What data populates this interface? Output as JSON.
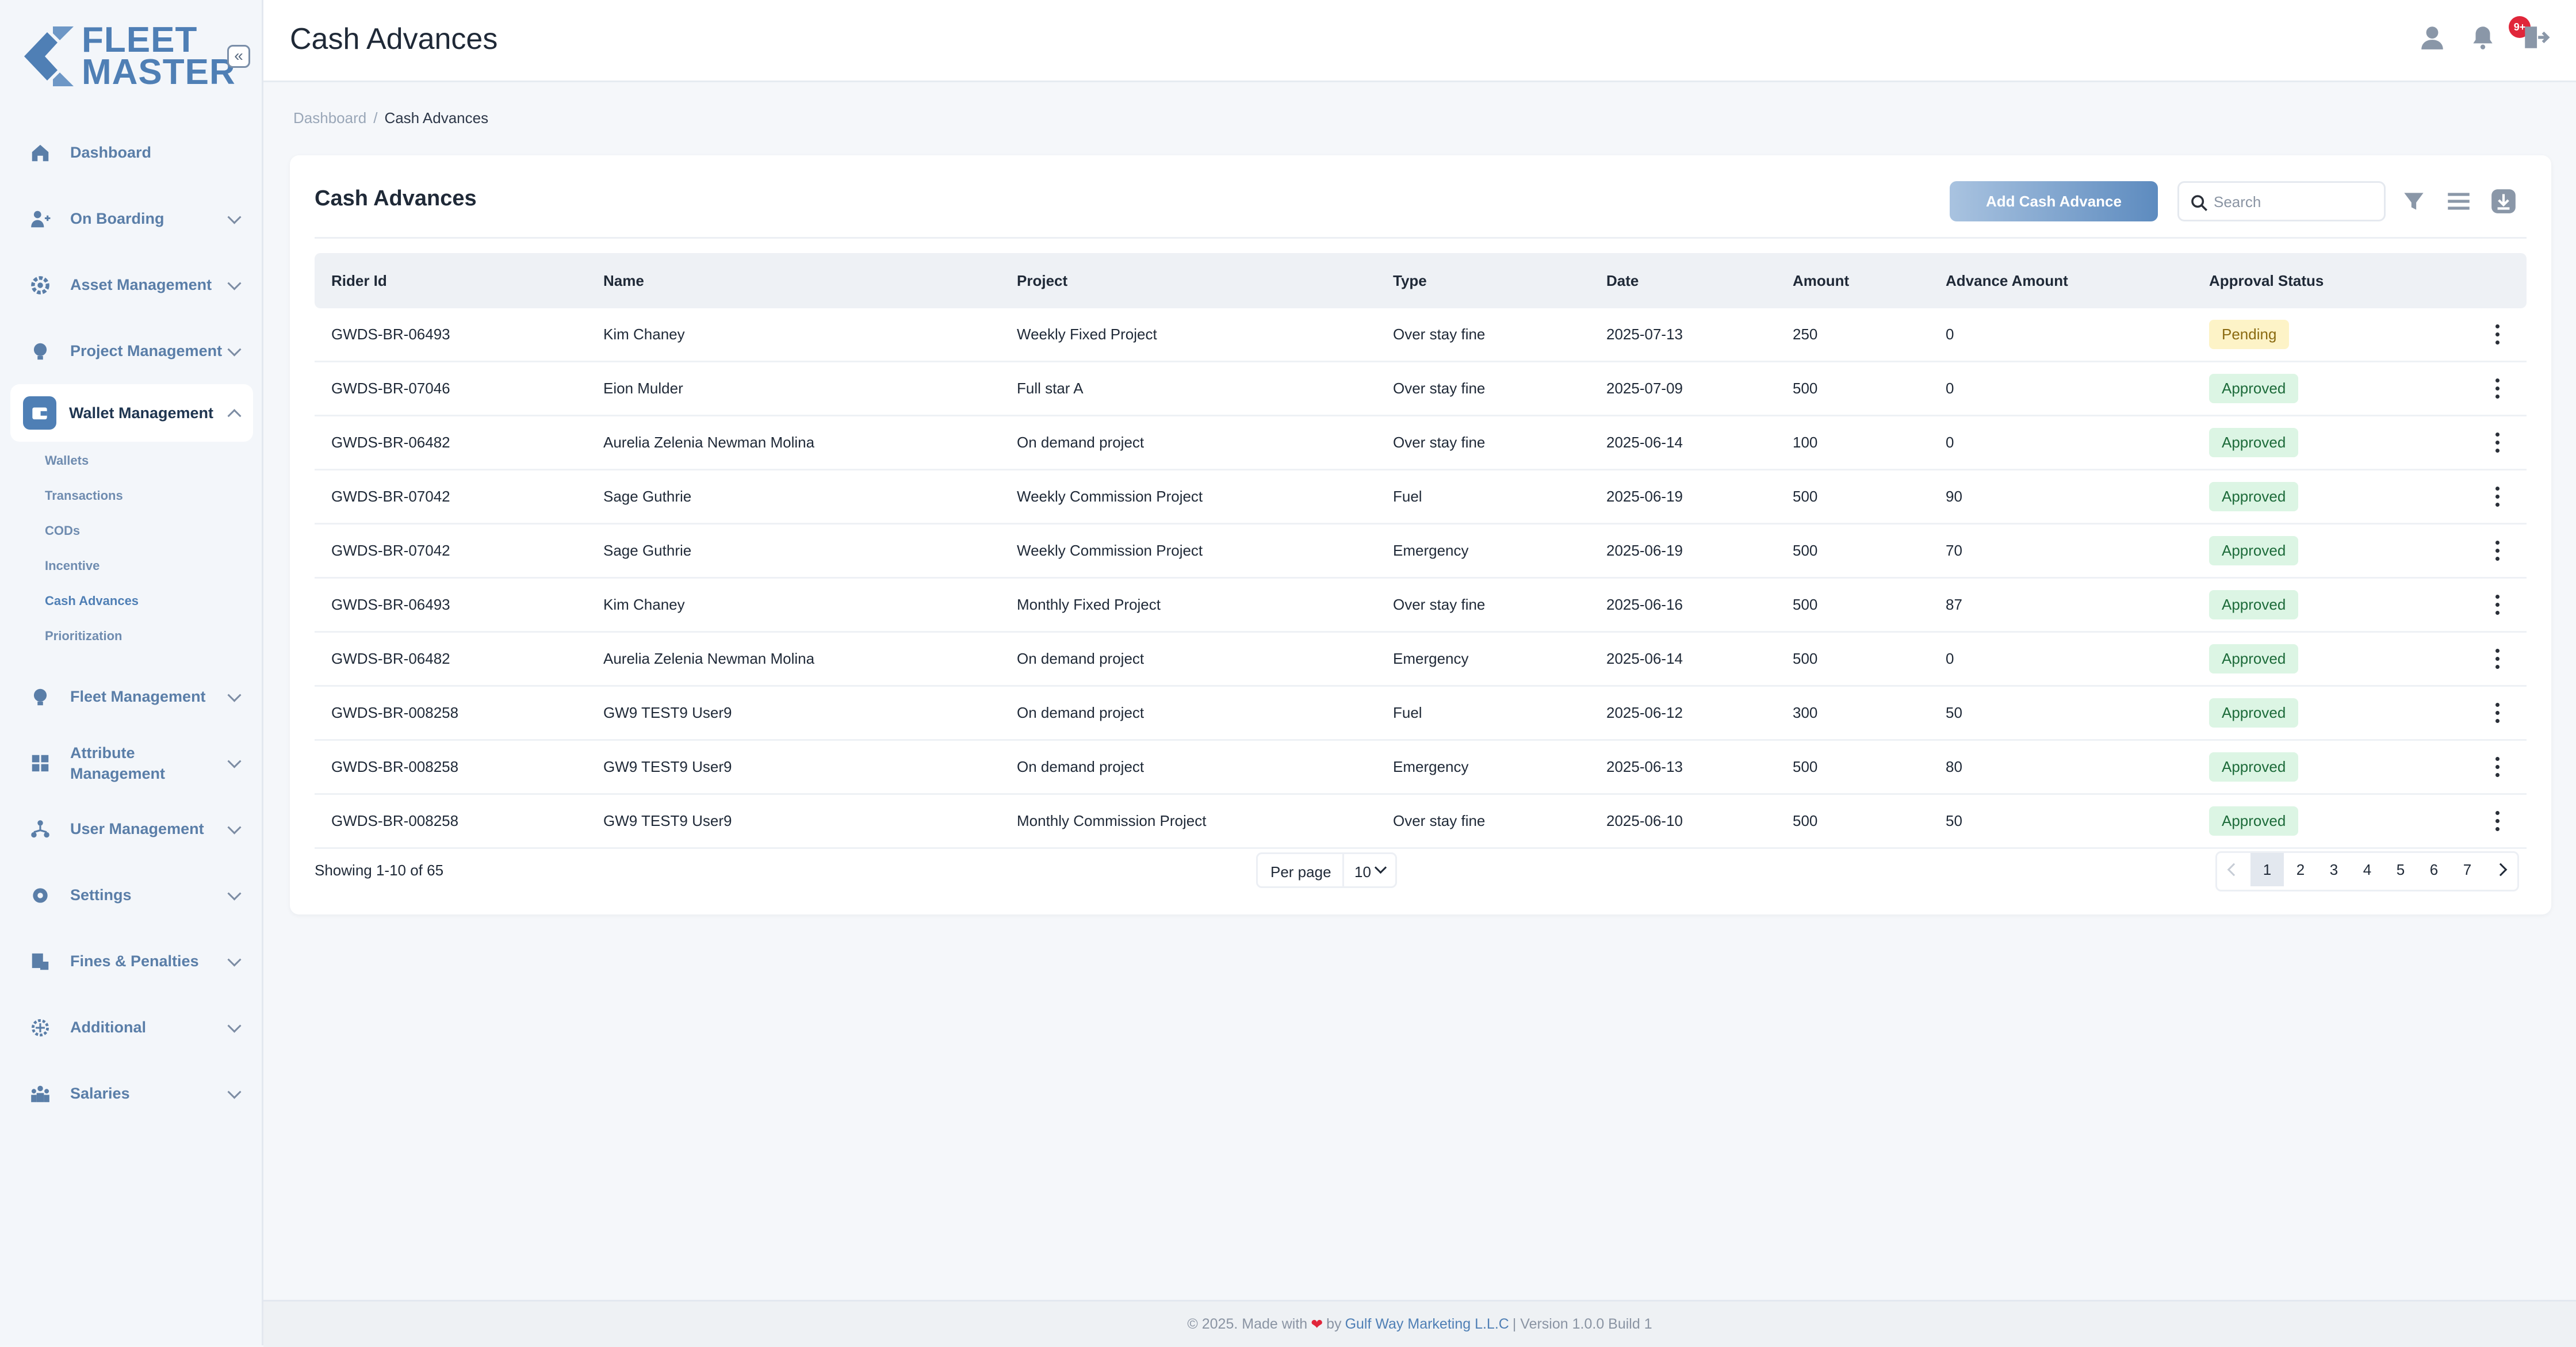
{
  "brand": {
    "line1": "FLEET",
    "line2": "MASTER",
    "color": "#4f7fb5"
  },
  "header": {
    "title": "Cash Advances",
    "notification_badge": "9+"
  },
  "breadcrumb": {
    "home": "Dashboard",
    "separator": "/",
    "current": "Cash Advances"
  },
  "sidebar": {
    "items": [
      {
        "label": "Dashboard",
        "icon": "home-icon"
      },
      {
        "label": "On Boarding",
        "icon": "user-plus-icon"
      },
      {
        "label": "Asset Management",
        "icon": "gear-cog-icon"
      },
      {
        "label": "Project Management",
        "icon": "bulb-icon"
      },
      {
        "label": "Wallet Management",
        "icon": "wallet-icon"
      },
      {
        "label": "Fleet Management",
        "icon": "car-icon"
      },
      {
        "label": "Attribute",
        "label2": "Management",
        "icon": "grid-icon"
      },
      {
        "label": "User Management",
        "icon": "users-icon"
      },
      {
        "label": "Settings",
        "icon": "settings-icon"
      },
      {
        "label": "Fines & Penalties",
        "icon": "receipt-icon"
      },
      {
        "label": "Additional",
        "icon": "plus-circle-icon"
      },
      {
        "label": "Salaries",
        "icon": "people-icon"
      }
    ],
    "wallet_sub": [
      "Wallets",
      "Transactions",
      "CODs",
      "Incentive",
      "Cash Advances",
      "Prioritization"
    ]
  },
  "card": {
    "title": "Cash Advances",
    "add_button": "Add Cash Advance",
    "search_placeholder": "Search"
  },
  "table": {
    "columns": [
      "Rider Id",
      "Name",
      "Project",
      "Type",
      "Date",
      "Amount",
      "Advance Amount",
      "Approval Status"
    ],
    "rows": [
      {
        "rider": "GWDS-BR-06493",
        "name": "Kim Chaney",
        "project": "Weekly Fixed Project",
        "type": "Over stay fine",
        "date": "2025-07-13",
        "amount": "250",
        "advance": "0",
        "status": "Pending"
      },
      {
        "rider": "GWDS-BR-07046",
        "name": "Eion Mulder",
        "project": "Full star A",
        "type": "Over stay fine",
        "date": "2025-07-09",
        "amount": "500",
        "advance": "0",
        "status": "Approved"
      },
      {
        "rider": "GWDS-BR-06482",
        "name": "Aurelia Zelenia Newman Molina",
        "project": "On demand project",
        "type": "Over stay fine",
        "date": "2025-06-14",
        "amount": "100",
        "advance": "0",
        "status": "Approved"
      },
      {
        "rider": "GWDS-BR-07042",
        "name": "Sage Guthrie",
        "project": "Weekly Commission Project",
        "type": "Fuel",
        "date": "2025-06-19",
        "amount": "500",
        "advance": "90",
        "status": "Approved"
      },
      {
        "rider": "GWDS-BR-07042",
        "name": "Sage Guthrie",
        "project": "Weekly Commission Project",
        "type": "Emergency",
        "date": "2025-06-19",
        "amount": "500",
        "advance": "70",
        "status": "Approved"
      },
      {
        "rider": "GWDS-BR-06493",
        "name": "Kim Chaney",
        "project": "Monthly Fixed Project",
        "type": "Over stay fine",
        "date": "2025-06-16",
        "amount": "500",
        "advance": "87",
        "status": "Approved"
      },
      {
        "rider": "GWDS-BR-06482",
        "name": "Aurelia Zelenia Newman Molina",
        "project": "On demand project",
        "type": "Emergency",
        "date": "2025-06-14",
        "amount": "500",
        "advance": "0",
        "status": "Approved"
      },
      {
        "rider": "GWDS-BR-008258",
        "name": "GW9 TEST9 User9",
        "project": "On demand project",
        "type": "Fuel",
        "date": "2025-06-12",
        "amount": "300",
        "advance": "50",
        "status": "Approved"
      },
      {
        "rider": "GWDS-BR-008258",
        "name": "GW9 TEST9 User9",
        "project": "On demand project",
        "type": "Emergency",
        "date": "2025-06-13",
        "amount": "500",
        "advance": "80",
        "status": "Approved"
      },
      {
        "rider": "GWDS-BR-008258",
        "name": "GW9 TEST9 User9",
        "project": "Monthly Commission Project",
        "type": "Over stay fine",
        "date": "2025-06-10",
        "amount": "500",
        "advance": "50",
        "status": "Approved"
      }
    ]
  },
  "pagination": {
    "showing": "Showing 1-10 of 65",
    "per_page_label": "Per page",
    "per_page_value": "10",
    "pages": [
      "1",
      "2",
      "3",
      "4",
      "5",
      "6",
      "7"
    ],
    "current": "1"
  },
  "footer": {
    "prefix": "© 2025. Made with",
    "by": "by",
    "company": "Gulf Way Marketing L.L.C",
    "suffix": "| Version 1.0.0 Build 1"
  },
  "colors": {
    "accent": "#4f7fb5",
    "pending_bg": "#fdf3c7",
    "approved_bg": "#dcf5e4",
    "badge": "#e0263a"
  }
}
